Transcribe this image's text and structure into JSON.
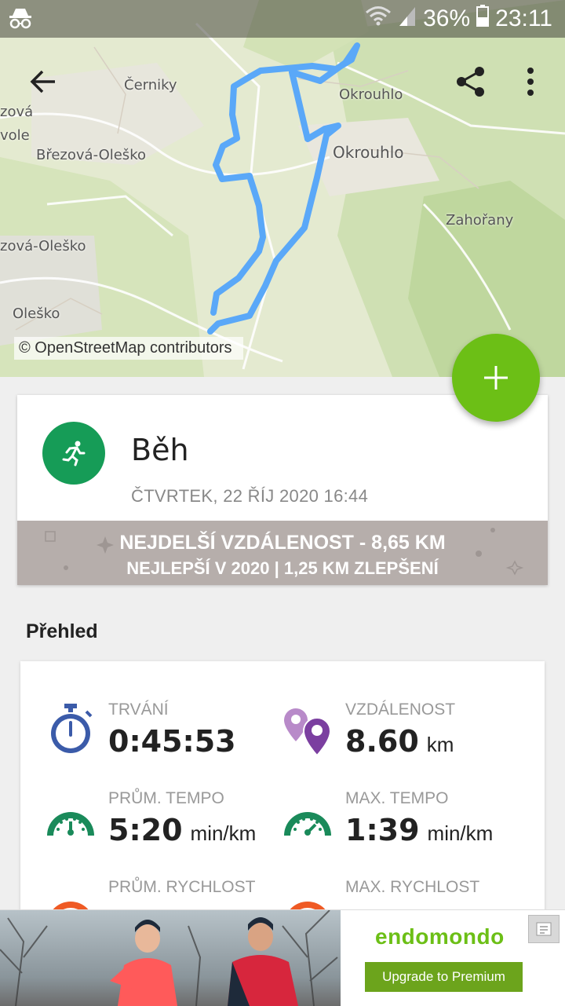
{
  "status_bar": {
    "battery_percent": "36%",
    "time": "23:11",
    "icons": [
      "incognito-icon",
      "wifi-icon",
      "signal-icon",
      "battery-icon"
    ]
  },
  "map": {
    "labels": [
      "Černiky",
      "Okrouhlo",
      "Okrouhlo",
      "Březová-Oleško",
      "Zahořany",
      "Oleško",
      "zová-Oleško",
      "zová",
      "vole"
    ],
    "attribution": "© OpenStreetMap contributors",
    "route_color": "#5aa8f8"
  },
  "toolbar": {
    "back_icon": "arrow-back-icon",
    "share_icon": "share-icon",
    "more_icon": "more-vert-icon"
  },
  "fab": {
    "icon": "plus-icon",
    "color": "#6cbf16"
  },
  "workout": {
    "sport": "Běh",
    "date": "ČTVRTEK, 22 ŘÍJ 2020 16:44",
    "record_line1": "NEJDELŠÍ VZDÁLENOST  -  8,65 KM",
    "record_line2": "NEJLEPŠÍ V 2020  |  1,25 KM ZLEPŠENÍ"
  },
  "overview": {
    "title": "Přehled",
    "stats": [
      {
        "label": "TRVÁNÍ",
        "value": "0:45:53",
        "unit": "",
        "icon": "stopwatch-icon"
      },
      {
        "label": "VZDÁLENOST",
        "value": "8.60",
        "unit": "km",
        "icon": "map-pin-icon"
      },
      {
        "label": "PRŮM. TEMPO",
        "value": "5:20",
        "unit": "min/km",
        "icon": "gauge-icon"
      },
      {
        "label": "MAX. TEMPO",
        "value": "1:39",
        "unit": "min/km",
        "icon": "gauge-icon"
      },
      {
        "label": "PRŮM. RYCHLOST",
        "value": "",
        "unit": "",
        "icon": "speedometer-icon"
      },
      {
        "label": "MAX. RYCHLOST",
        "value": "",
        "unit": "",
        "icon": "speedometer-icon"
      }
    ]
  },
  "ad": {
    "brand": "endomondo",
    "button": "Upgrade to Premium"
  },
  "colors": {
    "accent_green": "#6cbf16",
    "sport_green": "#169c57",
    "banner_gray": "#b6aeab",
    "stopwatch_blue": "#3b5ba9",
    "pin_purple": "#7b3fa0",
    "gauge_green": "#1a8a5a",
    "speed_orange": "#ef5a24"
  }
}
